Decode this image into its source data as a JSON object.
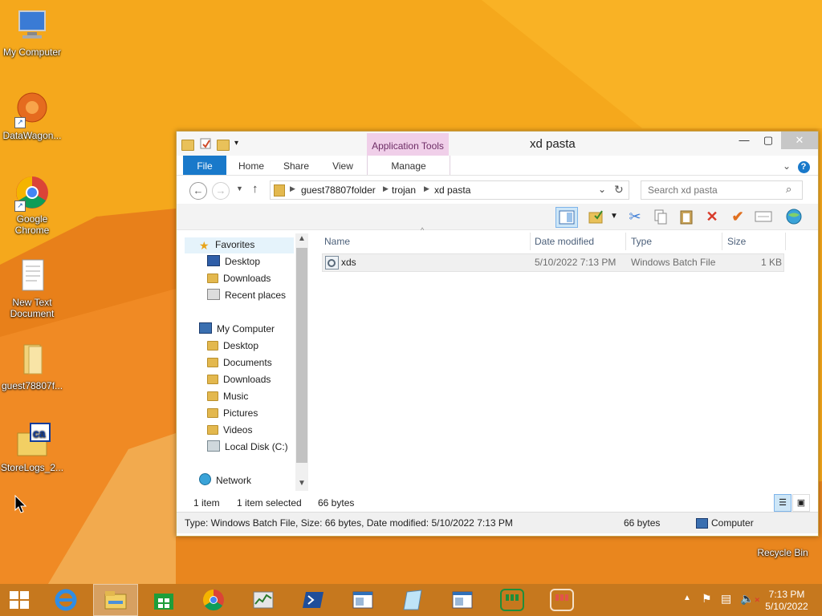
{
  "desktop": {
    "icons": [
      {
        "label": "My Computer"
      },
      {
        "label": "DataWagon..."
      },
      {
        "label": "Google Chrome"
      },
      {
        "label": "New Text Document"
      },
      {
        "label": "guest78807f..."
      },
      {
        "label": "StoreLogs_2..."
      },
      {
        "label": "Recycle Bin"
      }
    ]
  },
  "window": {
    "title": "xd pasta",
    "context_tab": "Application Tools",
    "ribbon_tabs": [
      "File",
      "Home",
      "Share",
      "View",
      "Manage"
    ],
    "breadcrumb": [
      "guest78807folder",
      "trojan",
      "xd pasta"
    ],
    "search_placeholder": "Search xd pasta",
    "nav": {
      "favorites": {
        "label": "Favorites",
        "items": [
          "Desktop",
          "Downloads",
          "Recent places"
        ]
      },
      "computer": {
        "label": "My Computer",
        "items": [
          "Desktop",
          "Documents",
          "Downloads",
          "Music",
          "Pictures",
          "Videos",
          "Local Disk (C:)"
        ]
      },
      "network": {
        "label": "Network"
      }
    },
    "columns": [
      "Name",
      "Date modified",
      "Type",
      "Size"
    ],
    "files": [
      {
        "name": "xds",
        "date": "5/10/2022 7:13 PM",
        "type": "Windows Batch File",
        "size": "1 KB"
      }
    ],
    "status": {
      "item_count": "1 item",
      "selected": "1 item selected",
      "bytes": "66 bytes",
      "details": "Type: Windows Batch File, Size: 66 bytes, Date modified: 5/10/2022 7:13 PM",
      "size2": "66 bytes",
      "location": "Computer"
    }
  },
  "taskbar": {
    "time": "7:13 PM",
    "date": "5/10/2022"
  },
  "colors": {
    "accent": "#1979ca",
    "context_tab": "#f0cfe9",
    "taskbar": "#c6781e"
  }
}
